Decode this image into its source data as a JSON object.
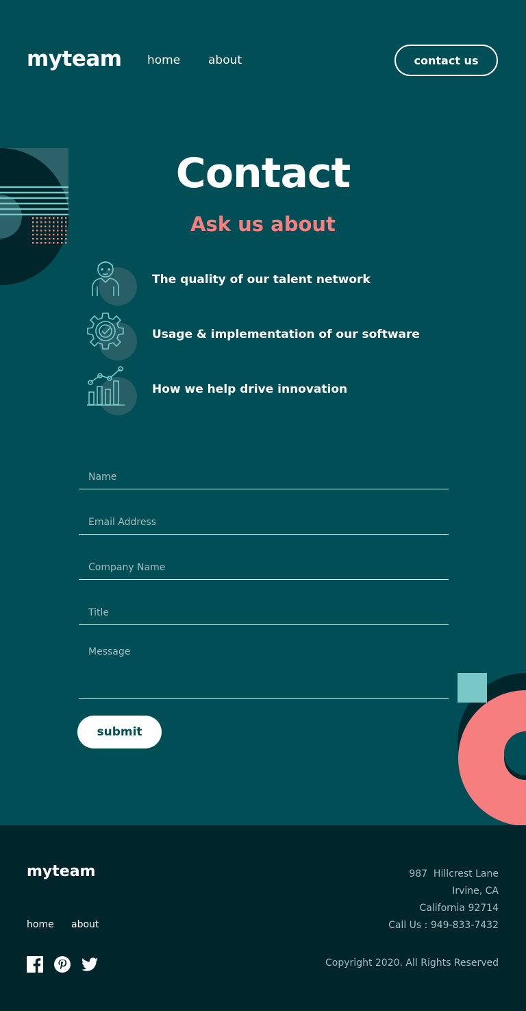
{
  "header": {
    "logo": "myteam",
    "nav": {
      "home": "home",
      "about": "about"
    },
    "cta": "contact us"
  },
  "hero": {
    "title": "Contact",
    "subtitle": "Ask us about",
    "items": [
      {
        "icon": "person-icon",
        "text": "The quality of our talent network"
      },
      {
        "icon": "gear-check-icon",
        "text": "Usage & implementation of our software"
      },
      {
        "icon": "chart-growth-icon",
        "text": "How we help drive innovation"
      }
    ]
  },
  "form": {
    "name_placeholder": "Name",
    "email_placeholder": "Email Address",
    "company_placeholder": "Company Name",
    "title_placeholder": "Title",
    "message_placeholder": "Message",
    "submit_label": "submit"
  },
  "footer": {
    "logo": "myteam",
    "nav": {
      "home": "home",
      "about": "about"
    },
    "social": [
      "facebook-icon",
      "pinterest-icon",
      "twitter-icon"
    ],
    "address": {
      "line1": "987  Hillcrest Lane",
      "line2": "Irvine, CA",
      "line3": "California 92714",
      "phone": "Call Us : 949-833-7432"
    },
    "copyright": "Copyright 2020. All Rights Reserved"
  },
  "colors": {
    "background": "#014E56",
    "footer_bg": "#00252A",
    "accent_coral": "#F67E7E",
    "accent_mint": "#79C8C7",
    "text_muted": "#A7BDC0"
  }
}
